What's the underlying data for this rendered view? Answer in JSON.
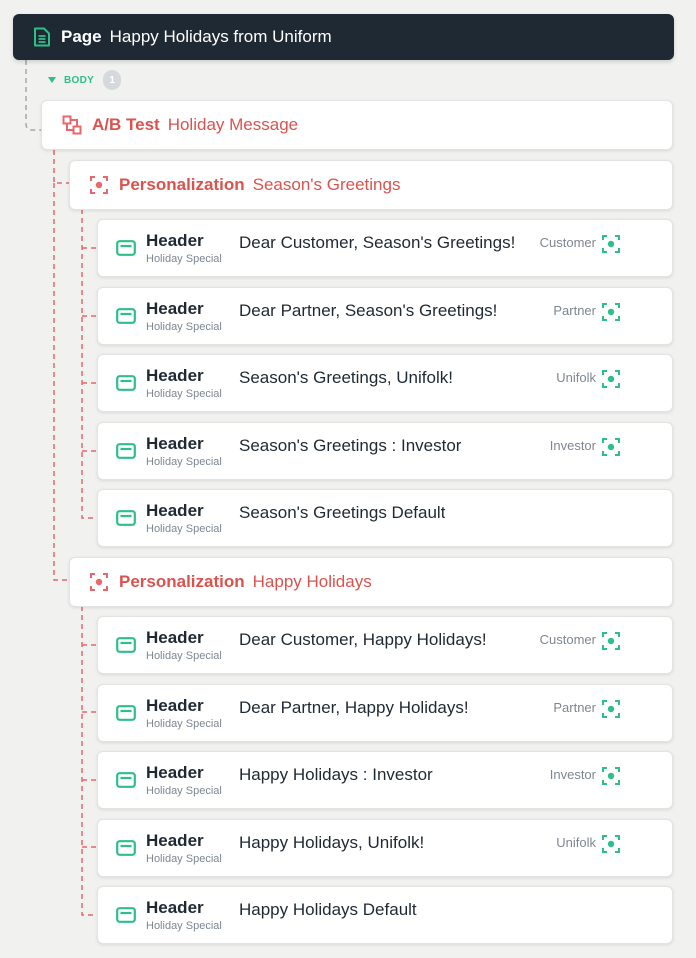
{
  "page": {
    "kind": "Page",
    "name": "Happy Holidays from Uniform",
    "icon": "page-document-icon"
  },
  "slot": {
    "label": "BODY",
    "count": "1"
  },
  "ab_test": {
    "kind": "A/B Test",
    "name": "Holiday Message",
    "icon": "ab-test-icon"
  },
  "personalizations": [
    {
      "kind": "Personalization",
      "name": "Season's Greetings",
      "icon": "personalization-icon",
      "variants": [
        {
          "kind": "Header",
          "subtitle": "Holiday Special",
          "title": "Dear Customer, Season's Greetings!",
          "audience": "Customer",
          "has_criteria": true
        },
        {
          "kind": "Header",
          "subtitle": "Holiday Special",
          "title": "Dear Partner, Season's Greetings!",
          "audience": "Partner",
          "has_criteria": true
        },
        {
          "kind": "Header",
          "subtitle": "Holiday Special",
          "title": "Season's Greetings, Unifolk!",
          "audience": "Unifolk",
          "has_criteria": true
        },
        {
          "kind": "Header",
          "subtitle": "Holiday Special",
          "title": "Season's Greetings : Investor",
          "audience": "Investor",
          "has_criteria": true
        },
        {
          "kind": "Header",
          "subtitle": "Holiday Special",
          "title": "Season's Greetings Default",
          "audience": "",
          "has_criteria": false
        }
      ]
    },
    {
      "kind": "Personalization",
      "name": "Happy Holidays",
      "icon": "personalization-icon",
      "variants": [
        {
          "kind": "Header",
          "subtitle": "Holiday Special",
          "title": "Dear Customer, Happy Holidays!",
          "audience": "Customer",
          "has_criteria": true
        },
        {
          "kind": "Header",
          "subtitle": "Holiday Special",
          "title": "Dear Partner, Happy Holidays!",
          "audience": "Partner",
          "has_criteria": true
        },
        {
          "kind": "Header",
          "subtitle": "Holiday Special",
          "title": "Happy Holidays : Investor",
          "audience": "Investor",
          "has_criteria": true
        },
        {
          "kind": "Header",
          "subtitle": "Holiday Special",
          "title": "Happy Holidays, Unifolk!",
          "audience": "Unifolk",
          "has_criteria": true
        },
        {
          "kind": "Header",
          "subtitle": "Holiday Special",
          "title": "Happy Holidays Default",
          "audience": "",
          "has_criteria": false
        }
      ]
    }
  ],
  "colors": {
    "page_bar": "#1f2933",
    "accent_green": "#2dbe8a",
    "accent_red": "#d9534f",
    "muted_text": "#7d8792"
  }
}
